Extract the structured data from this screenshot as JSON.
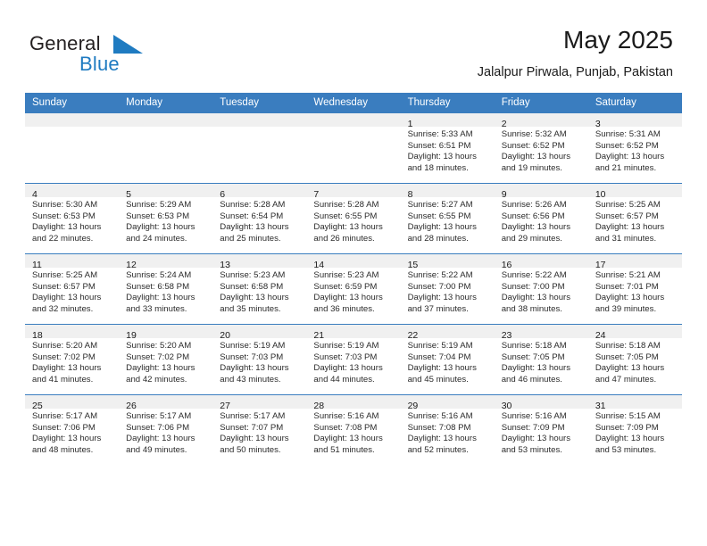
{
  "brand": {
    "name_part1": "General",
    "name_part2": "Blue",
    "mark_icon": "triangle-logo-icon",
    "accent_color": "#1f7bc1"
  },
  "header": {
    "title": "May 2025",
    "subtitle": "Jalalpur Pirwala, Punjab, Pakistan"
  },
  "colors": {
    "header_row_background": "#3a7dbf",
    "header_row_text": "#ffffff",
    "daynum_band": "#f0f0f0",
    "grid_line": "#3a7dbf",
    "body_text": "#2b2b2b"
  },
  "weekday_headers": [
    "Sunday",
    "Monday",
    "Tuesday",
    "Wednesday",
    "Thursday",
    "Friday",
    "Saturday"
  ],
  "weeks": [
    [
      {
        "day": "",
        "lines": []
      },
      {
        "day": "",
        "lines": []
      },
      {
        "day": "",
        "lines": []
      },
      {
        "day": "",
        "lines": []
      },
      {
        "day": "1",
        "lines": [
          "Sunrise: 5:33 AM",
          "Sunset: 6:51 PM",
          "Daylight: 13 hours",
          "and 18 minutes."
        ]
      },
      {
        "day": "2",
        "lines": [
          "Sunrise: 5:32 AM",
          "Sunset: 6:52 PM",
          "Daylight: 13 hours",
          "and 19 minutes."
        ]
      },
      {
        "day": "3",
        "lines": [
          "Sunrise: 5:31 AM",
          "Sunset: 6:52 PM",
          "Daylight: 13 hours",
          "and 21 minutes."
        ]
      }
    ],
    [
      {
        "day": "4",
        "lines": [
          "Sunrise: 5:30 AM",
          "Sunset: 6:53 PM",
          "Daylight: 13 hours",
          "and 22 minutes."
        ]
      },
      {
        "day": "5",
        "lines": [
          "Sunrise: 5:29 AM",
          "Sunset: 6:53 PM",
          "Daylight: 13 hours",
          "and 24 minutes."
        ]
      },
      {
        "day": "6",
        "lines": [
          "Sunrise: 5:28 AM",
          "Sunset: 6:54 PM",
          "Daylight: 13 hours",
          "and 25 minutes."
        ]
      },
      {
        "day": "7",
        "lines": [
          "Sunrise: 5:28 AM",
          "Sunset: 6:55 PM",
          "Daylight: 13 hours",
          "and 26 minutes."
        ]
      },
      {
        "day": "8",
        "lines": [
          "Sunrise: 5:27 AM",
          "Sunset: 6:55 PM",
          "Daylight: 13 hours",
          "and 28 minutes."
        ]
      },
      {
        "day": "9",
        "lines": [
          "Sunrise: 5:26 AM",
          "Sunset: 6:56 PM",
          "Daylight: 13 hours",
          "and 29 minutes."
        ]
      },
      {
        "day": "10",
        "lines": [
          "Sunrise: 5:25 AM",
          "Sunset: 6:57 PM",
          "Daylight: 13 hours",
          "and 31 minutes."
        ]
      }
    ],
    [
      {
        "day": "11",
        "lines": [
          "Sunrise: 5:25 AM",
          "Sunset: 6:57 PM",
          "Daylight: 13 hours",
          "and 32 minutes."
        ]
      },
      {
        "day": "12",
        "lines": [
          "Sunrise: 5:24 AM",
          "Sunset: 6:58 PM",
          "Daylight: 13 hours",
          "and 33 minutes."
        ]
      },
      {
        "day": "13",
        "lines": [
          "Sunrise: 5:23 AM",
          "Sunset: 6:58 PM",
          "Daylight: 13 hours",
          "and 35 minutes."
        ]
      },
      {
        "day": "14",
        "lines": [
          "Sunrise: 5:23 AM",
          "Sunset: 6:59 PM",
          "Daylight: 13 hours",
          "and 36 minutes."
        ]
      },
      {
        "day": "15",
        "lines": [
          "Sunrise: 5:22 AM",
          "Sunset: 7:00 PM",
          "Daylight: 13 hours",
          "and 37 minutes."
        ]
      },
      {
        "day": "16",
        "lines": [
          "Sunrise: 5:22 AM",
          "Sunset: 7:00 PM",
          "Daylight: 13 hours",
          "and 38 minutes."
        ]
      },
      {
        "day": "17",
        "lines": [
          "Sunrise: 5:21 AM",
          "Sunset: 7:01 PM",
          "Daylight: 13 hours",
          "and 39 minutes."
        ]
      }
    ],
    [
      {
        "day": "18",
        "lines": [
          "Sunrise: 5:20 AM",
          "Sunset: 7:02 PM",
          "Daylight: 13 hours",
          "and 41 minutes."
        ]
      },
      {
        "day": "19",
        "lines": [
          "Sunrise: 5:20 AM",
          "Sunset: 7:02 PM",
          "Daylight: 13 hours",
          "and 42 minutes."
        ]
      },
      {
        "day": "20",
        "lines": [
          "Sunrise: 5:19 AM",
          "Sunset: 7:03 PM",
          "Daylight: 13 hours",
          "and 43 minutes."
        ]
      },
      {
        "day": "21",
        "lines": [
          "Sunrise: 5:19 AM",
          "Sunset: 7:03 PM",
          "Daylight: 13 hours",
          "and 44 minutes."
        ]
      },
      {
        "day": "22",
        "lines": [
          "Sunrise: 5:19 AM",
          "Sunset: 7:04 PM",
          "Daylight: 13 hours",
          "and 45 minutes."
        ]
      },
      {
        "day": "23",
        "lines": [
          "Sunrise: 5:18 AM",
          "Sunset: 7:05 PM",
          "Daylight: 13 hours",
          "and 46 minutes."
        ]
      },
      {
        "day": "24",
        "lines": [
          "Sunrise: 5:18 AM",
          "Sunset: 7:05 PM",
          "Daylight: 13 hours",
          "and 47 minutes."
        ]
      }
    ],
    [
      {
        "day": "25",
        "lines": [
          "Sunrise: 5:17 AM",
          "Sunset: 7:06 PM",
          "Daylight: 13 hours",
          "and 48 minutes."
        ]
      },
      {
        "day": "26",
        "lines": [
          "Sunrise: 5:17 AM",
          "Sunset: 7:06 PM",
          "Daylight: 13 hours",
          "and 49 minutes."
        ]
      },
      {
        "day": "27",
        "lines": [
          "Sunrise: 5:17 AM",
          "Sunset: 7:07 PM",
          "Daylight: 13 hours",
          "and 50 minutes."
        ]
      },
      {
        "day": "28",
        "lines": [
          "Sunrise: 5:16 AM",
          "Sunset: 7:08 PM",
          "Daylight: 13 hours",
          "and 51 minutes."
        ]
      },
      {
        "day": "29",
        "lines": [
          "Sunrise: 5:16 AM",
          "Sunset: 7:08 PM",
          "Daylight: 13 hours",
          "and 52 minutes."
        ]
      },
      {
        "day": "30",
        "lines": [
          "Sunrise: 5:16 AM",
          "Sunset: 7:09 PM",
          "Daylight: 13 hours",
          "and 53 minutes."
        ]
      },
      {
        "day": "31",
        "lines": [
          "Sunrise: 5:15 AM",
          "Sunset: 7:09 PM",
          "Daylight: 13 hours",
          "and 53 minutes."
        ]
      }
    ]
  ]
}
